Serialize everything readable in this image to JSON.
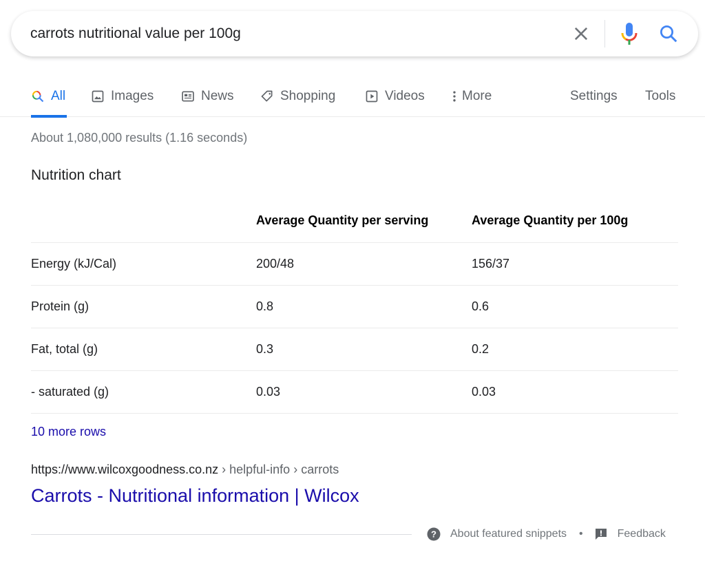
{
  "search": {
    "query": "carrots nutritional value per 100g",
    "clear_icon": "close-icon",
    "mic_icon": "microphone-icon",
    "search_icon": "search-icon"
  },
  "tabs": [
    {
      "label": "All",
      "icon": "search-icon",
      "active": true
    },
    {
      "label": "Images",
      "icon": "image-icon"
    },
    {
      "label": "News",
      "icon": "newspaper-icon"
    },
    {
      "label": "Shopping",
      "icon": "tag-icon"
    },
    {
      "label": "Videos",
      "icon": "play-icon"
    },
    {
      "label": "More",
      "icon": "more-vertical-icon"
    },
    {
      "label": "Settings"
    },
    {
      "label": "Tools"
    }
  ],
  "result_stats": "About 1,080,000 results (1.16 seconds)",
  "snippet": {
    "title": "Nutrition chart",
    "table": {
      "headers": [
        "",
        "Average Quantity per serving",
        "Average Quantity per 100g"
      ],
      "rows": [
        [
          "Energy (kJ/Cal)",
          "200/48",
          "156/37"
        ],
        [
          "Protein (g)",
          "0.8",
          "0.6"
        ],
        [
          "Fat, total (g)",
          "0.3",
          "0.2"
        ],
        [
          "- saturated (g)",
          "0.03",
          "0.03"
        ]
      ]
    },
    "more_rows": "10 more rows"
  },
  "result": {
    "cite_domain": "https://www.wilcoxgoodness.co.nz",
    "cite_path": " › helpful-info › carrots",
    "title": "Carrots - Nutritional information | Wilcox"
  },
  "footer": {
    "about_label": "About featured snippets",
    "separator": "•",
    "feedback_label": "Feedback"
  },
  "colors": {
    "accent": "#1a73e8",
    "link": "#1a0dab",
    "mic_blue": "#4285f4",
    "mic_red": "#ea4335",
    "mic_yellow": "#fbbc05",
    "mic_green": "#34a853"
  }
}
